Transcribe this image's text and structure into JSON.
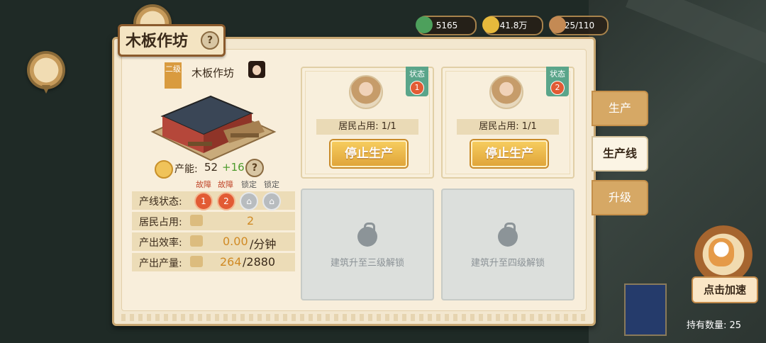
{
  "resources": [
    {
      "icon": "jade-coin-icon",
      "value": "5165"
    },
    {
      "icon": "gold-coin-icon",
      "value": "41.8万"
    },
    {
      "icon": "population-icon",
      "value": "25/110"
    }
  ],
  "building": {
    "title": "木板作坊",
    "level": "二级",
    "name": "木板作坊",
    "capacity_label": "产能:",
    "capacity_value": "52",
    "capacity_bonus": "+16"
  },
  "line_status": {
    "label": "产线状态:",
    "tags": [
      "故障",
      "故障",
      "锁定",
      "锁定"
    ],
    "lines": [
      {
        "num": "1",
        "state": "fault"
      },
      {
        "num": "2",
        "state": "fault"
      },
      {
        "num": "",
        "state": "locked"
      },
      {
        "num": "",
        "state": "locked"
      }
    ]
  },
  "stats": {
    "residents_label": "居民占用:",
    "residents_value": "2",
    "efficiency_label": "产出效率:",
    "efficiency_value": "0.00",
    "efficiency_unit": "/分钟",
    "output_label": "产出产量:",
    "output_value": "264",
    "output_max": "/2880"
  },
  "cards": [
    {
      "state_label": "状态",
      "state_num": "1",
      "occupancy": "居民占用: 1/1",
      "button": "停止生产"
    },
    {
      "state_label": "状态",
      "state_num": "2",
      "occupancy": "居民占用: 1/1",
      "button": "停止生产"
    }
  ],
  "locked_cards": [
    {
      "text": "建筑升至三级解锁"
    },
    {
      "text": "建筑升至四级解锁"
    }
  ],
  "tabs": [
    "生产",
    "生产线",
    "升级"
  ],
  "speed_up": {
    "label": "点击加速"
  },
  "holding": {
    "label": "持有数量:",
    "value": "25"
  },
  "colors": {
    "fault": "#e25b34",
    "bonus": "#4d9b2c",
    "accent": "#e0a53a",
    "output": "#d08a24"
  }
}
